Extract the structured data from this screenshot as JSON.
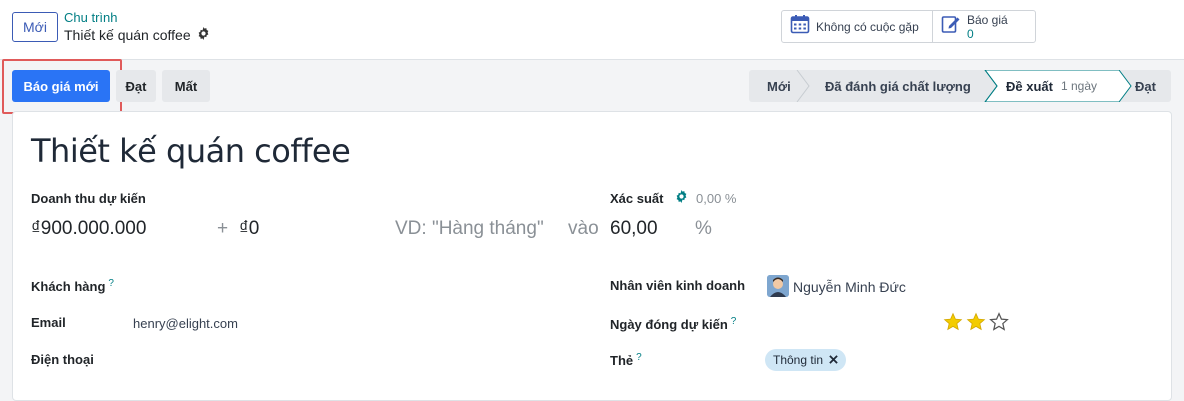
{
  "header": {
    "new_button": "Mới",
    "breadcrumb_parent": "Chu trình",
    "breadcrumb_current": "Thiết kế quán coffee"
  },
  "smart_buttons": {
    "meetings_label": "Không có cuộc gặp",
    "quotations_label": "Báo giá",
    "quotations_count": "0"
  },
  "actions": {
    "new_quotation": "Báo giá mới",
    "won": "Đạt",
    "lost": "Mất"
  },
  "stages": {
    "items": [
      "Mới",
      "Đã đánh giá chất lượng",
      "Đề xuất",
      "Đạt"
    ],
    "active_duration": "1 ngày",
    "active_index": 2
  },
  "form": {
    "title": "Thiết kế quán coffee",
    "expected_revenue_label": "Doanh thu dự kiến",
    "expected_revenue": "₫900.000.000",
    "plus": "+",
    "recurring_revenue": "₫0",
    "recurring_plan_placeholder": "VD: \"Hàng tháng\"",
    "at_word": "vào",
    "probability_label": "Xác suất",
    "probability_auto": "0,00 %",
    "probability": "60,00",
    "probability_unit": "%",
    "customer_label": "Khách hàng",
    "email_label": "Email",
    "email": "henry@elight.com",
    "phone_label": "Điện thoại",
    "salesperson_label": "Nhân viên kinh doanh",
    "salesperson": "Nguyễn Minh Đức",
    "deadline_label": "Ngày đóng dự kiến",
    "priority_stars": 2,
    "priority_max": 3,
    "tags_label": "Thẻ",
    "tag": "Thông tin",
    "help_mark": "?"
  },
  "colors": {
    "primary": "#2a74f5",
    "teal": "#017e84",
    "star": "#f3cc00",
    "highlight": "#e05a5a"
  }
}
